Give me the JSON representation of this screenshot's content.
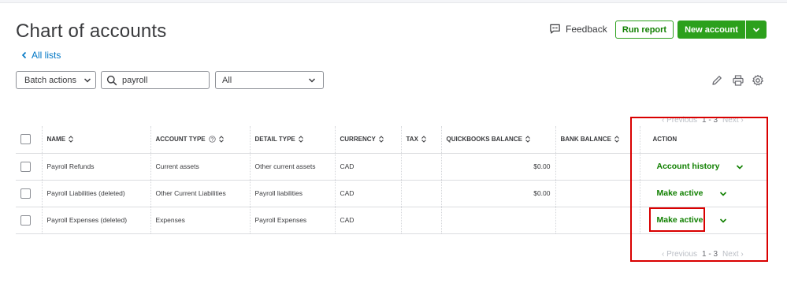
{
  "header": {
    "title": "Chart of accounts",
    "back_link": "All lists",
    "feedback_label": "Feedback",
    "run_report_label": "Run report",
    "new_account_label": "New account"
  },
  "toolbar": {
    "batch_actions_label": "Batch actions",
    "search_value": "payroll",
    "filter_value": "All"
  },
  "pagination": {
    "previous_label": "Previous",
    "range": "1 - 3",
    "next_label": "Next"
  },
  "table": {
    "columns": {
      "name": "NAME",
      "account_type": "ACCOUNT TYPE",
      "detail_type": "DETAIL TYPE",
      "currency": "CURRENCY",
      "tax": "TAX",
      "qb_balance": "QUICKBOOKS BALANCE",
      "bank_balance": "BANK BALANCE",
      "action": "ACTION"
    },
    "rows": [
      {
        "name": "Payroll Refunds",
        "account_type": "Current assets",
        "detail_type": "Other current assets",
        "currency": "CAD",
        "tax": "",
        "qb_balance": "$0.00",
        "bank_balance": "",
        "action": "Account history"
      },
      {
        "name": "Payroll Liabilities (deleted)",
        "account_type": "Other Current Liabilities",
        "detail_type": "Payroll liabilities",
        "currency": "CAD",
        "tax": "",
        "qb_balance": "$0.00",
        "bank_balance": "",
        "action": "Make active"
      },
      {
        "name": "Payroll Expenses (deleted)",
        "account_type": "Expenses",
        "detail_type": "Payroll Expenses",
        "currency": "CAD",
        "tax": "",
        "qb_balance": "",
        "bank_balance": "",
        "action": "Make active"
      }
    ]
  },
  "icons": {
    "edit": "pencil-icon",
    "print": "printer-icon",
    "settings": "gear-icon",
    "feedback": "speech-bubble-icon",
    "search": "search-icon"
  },
  "colors": {
    "accent_green": "#2ca01c",
    "link_green": "#108000",
    "link_blue": "#0077c5",
    "annotation_red": "#d90000"
  }
}
